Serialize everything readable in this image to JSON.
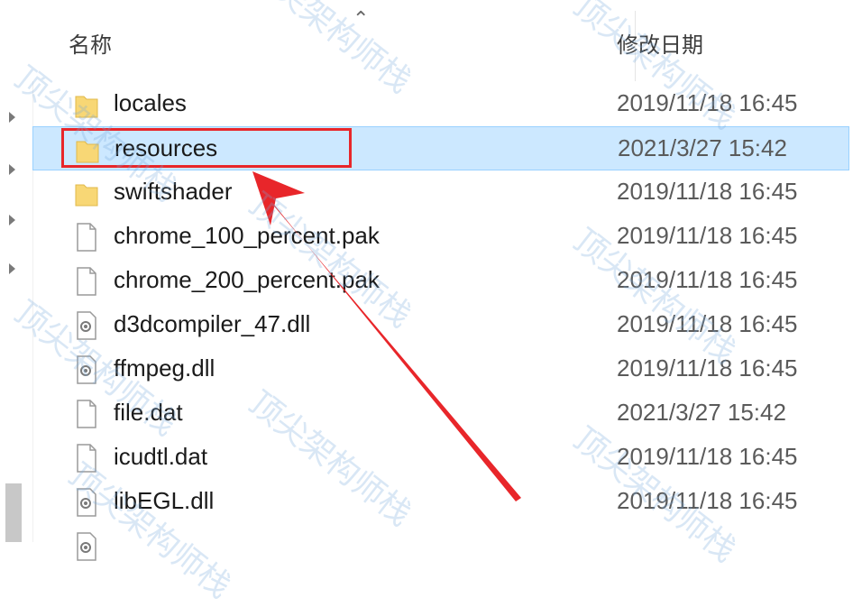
{
  "header": {
    "name_col": "名称",
    "date_col": "修改日期"
  },
  "files": [
    {
      "name": "locales",
      "date": "2019/11/18 16:45",
      "icon": "folder-icon"
    },
    {
      "name": "resources",
      "date": "2021/3/27 15:42",
      "icon": "folder-icon",
      "selected": true
    },
    {
      "name": "swiftshader",
      "date": "2019/11/18 16:45",
      "icon": "folder-icon"
    },
    {
      "name": "chrome_100_percent.pak",
      "date": "2019/11/18 16:45",
      "icon": "file-icon"
    },
    {
      "name": "chrome_200_percent.pak",
      "date": "2019/11/18 16:45",
      "icon": "file-icon"
    },
    {
      "name": "d3dcompiler_47.dll",
      "date": "2019/11/18 16:45",
      "icon": "dll-icon"
    },
    {
      "name": "ffmpeg.dll",
      "date": "2019/11/18 16:45",
      "icon": "dll-icon"
    },
    {
      "name": "file.dat",
      "date": "2021/3/27 15:42",
      "icon": "file-icon"
    },
    {
      "name": "icudtl.dat",
      "date": "2019/11/18 16:45",
      "icon": "file-icon"
    },
    {
      "name": "libEGL.dll",
      "date": "2019/11/18 16:45",
      "icon": "dll-icon"
    }
  ],
  "watermark": "顶尖架构师栈",
  "colors": {
    "highlight": "#e8262a",
    "selection": "#cce8ff",
    "folder": "#f8d775"
  }
}
